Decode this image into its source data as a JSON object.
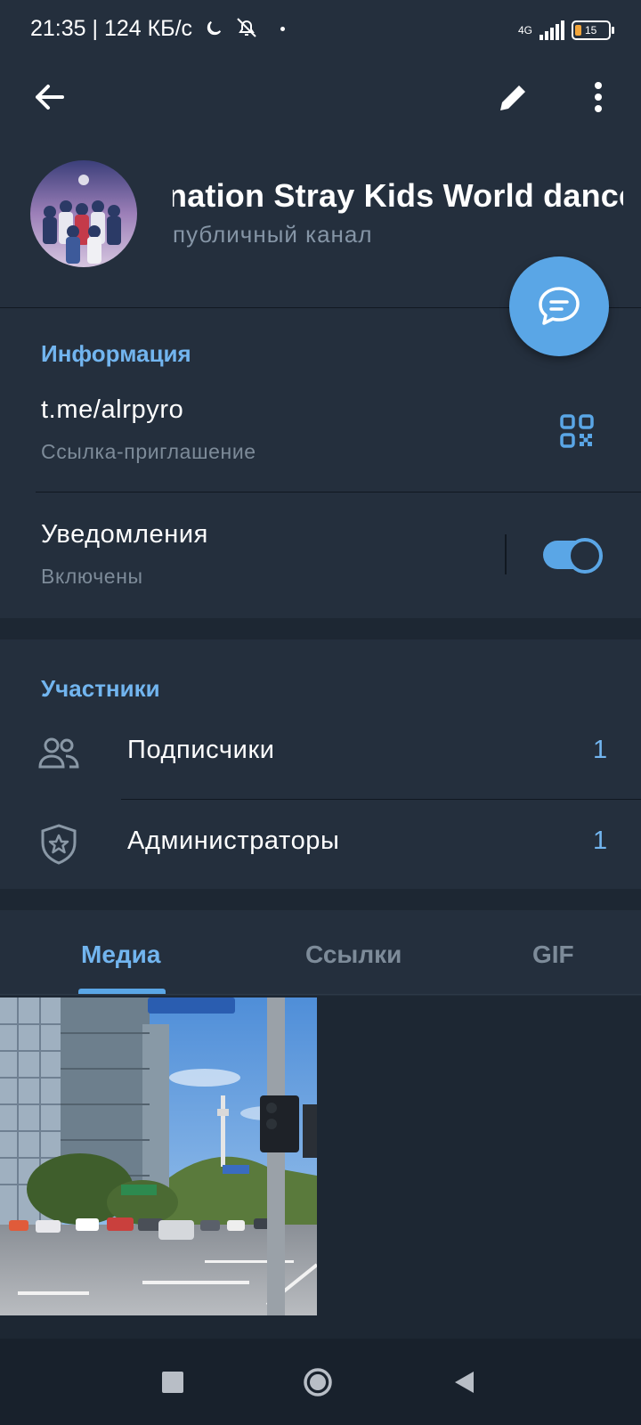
{
  "status_bar": {
    "text": "21:35 | 124 КБ/с",
    "network": "4G",
    "battery": "15"
  },
  "header": {
    "channel_title": "nation   Stray Kids World dance",
    "subtitle": "публичный канал"
  },
  "info": {
    "section_title": "Информация",
    "link": "t.me/alrpyro",
    "link_caption": "Ссылка-приглашение",
    "notifications_label": "Уведомления",
    "notifications_state": "Включены",
    "notifications_enabled": true
  },
  "members": {
    "section_title": "Участники",
    "subscribers_label": "Подписчики",
    "subscribers_count": "1",
    "admins_label": "Администраторы",
    "admins_count": "1"
  },
  "tabs": [
    {
      "label": "Медиа",
      "active": true
    },
    {
      "label": "Ссылки",
      "active": false
    },
    {
      "label": "GIF",
      "active": false
    }
  ],
  "colors": {
    "accent": "#5aa6e6",
    "header_bg": "#242f3d",
    "page_bg": "#1d2733"
  }
}
